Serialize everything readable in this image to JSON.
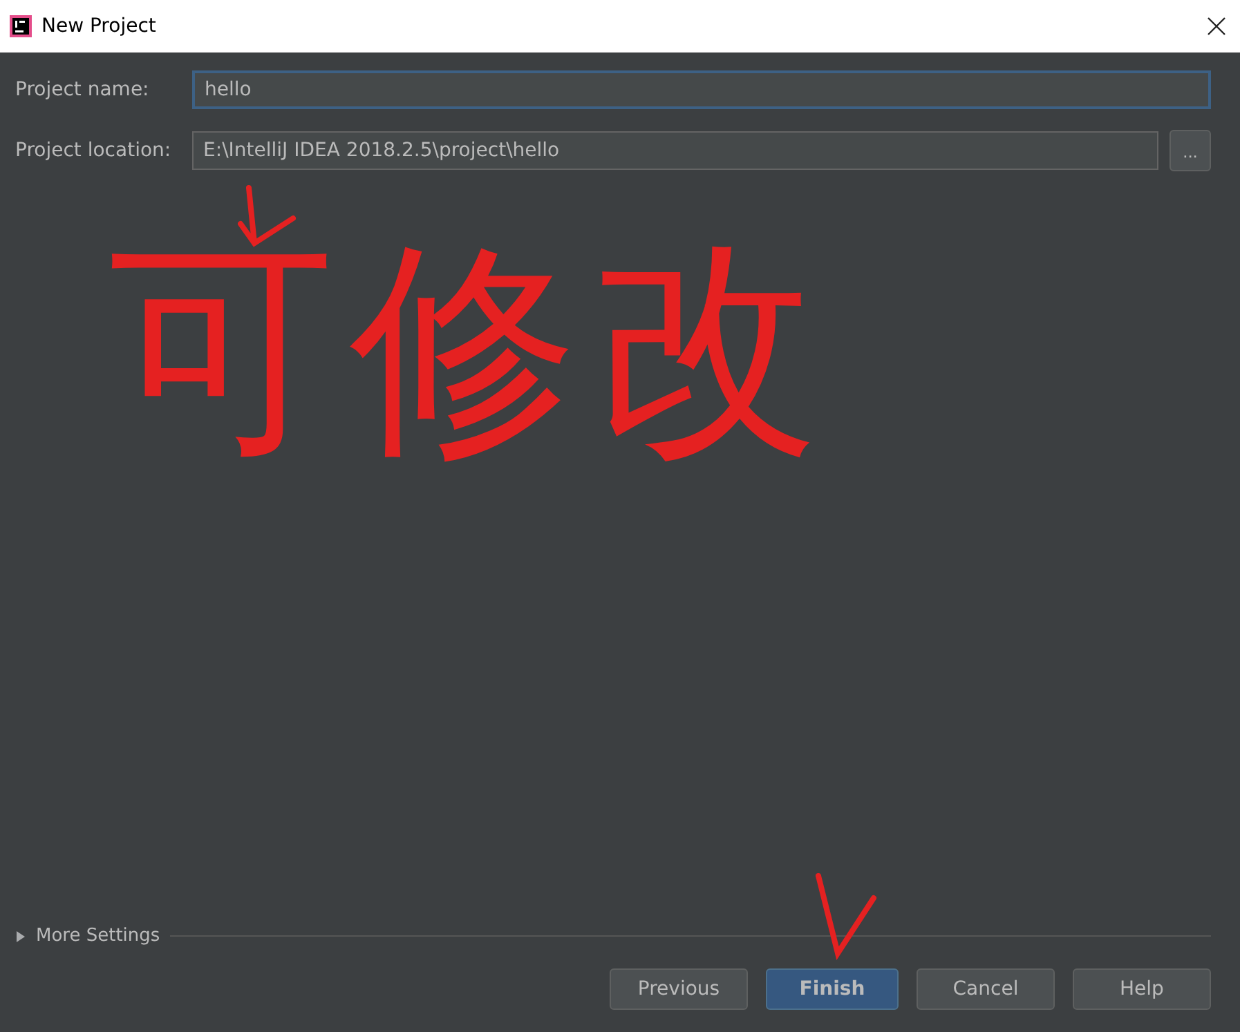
{
  "window": {
    "title": "New Project"
  },
  "fields": [
    {
      "label": "Project name:",
      "value": "hello",
      "focused": true
    },
    {
      "label": "Project location:",
      "value": "E:\\IntelliJ IDEA 2018.2.5\\project\\hello",
      "focused": false
    }
  ],
  "browse_button": "...",
  "annotation": {
    "text": "可修改"
  },
  "more_settings": {
    "label": "More Settings",
    "expanded": false
  },
  "buttons": [
    {
      "label": "Previous",
      "default": false
    },
    {
      "label": "Finish",
      "default": true
    },
    {
      "label": "Cancel",
      "default": false
    },
    {
      "label": "Help",
      "default": false
    }
  ]
}
